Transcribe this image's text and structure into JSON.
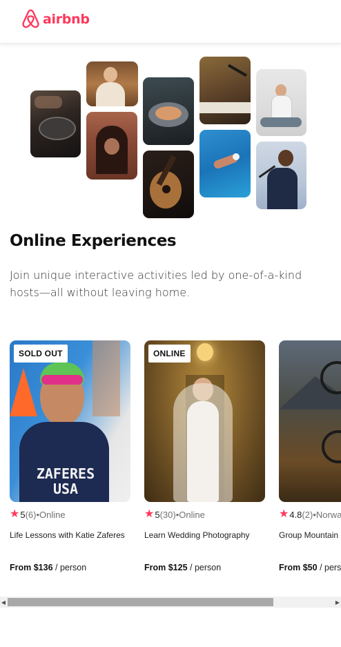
{
  "brand": {
    "name": "airbnb",
    "color": "#FF385C"
  },
  "hero": {
    "title": "Online Experiences",
    "subtitle": "Join unique interactive activities led by one-of-a-kind hosts—all without leaving home."
  },
  "collage": [
    {
      "name": "cooking"
    },
    {
      "name": "barista"
    },
    {
      "name": "dancer"
    },
    {
      "name": "food-bowl"
    },
    {
      "name": "guitar"
    },
    {
      "name": "piano"
    },
    {
      "name": "swimmer"
    },
    {
      "name": "yoga"
    },
    {
      "name": "singer"
    }
  ],
  "experiences": [
    {
      "badge": "SOLD OUT",
      "rating": "5",
      "reviews": "(6)",
      "location": "•Online",
      "title": "Life Lessons with Katie Zaferes",
      "price_label": "From $136",
      "per": " / person",
      "jersey_line1": "ZAFERES",
      "jersey_line2": "USA"
    },
    {
      "badge": "ONLINE",
      "rating": "5",
      "reviews": "(30)",
      "location": "•Online",
      "title": "Learn Wedding Photography",
      "price_label": "From $125",
      "per": " / person"
    },
    {
      "badge": "",
      "rating": "4.8",
      "reviews": "(2)",
      "location": "•Norway",
      "title": "Group Mountain Biking",
      "price_label": "From $50",
      "per": " / person"
    }
  ],
  "scrollbar": {
    "left_arrow": "◀",
    "right_arrow": "▶",
    "position": 0.78
  },
  "icons": {
    "star": "star-icon",
    "logo": "airbnb-logo-icon"
  }
}
